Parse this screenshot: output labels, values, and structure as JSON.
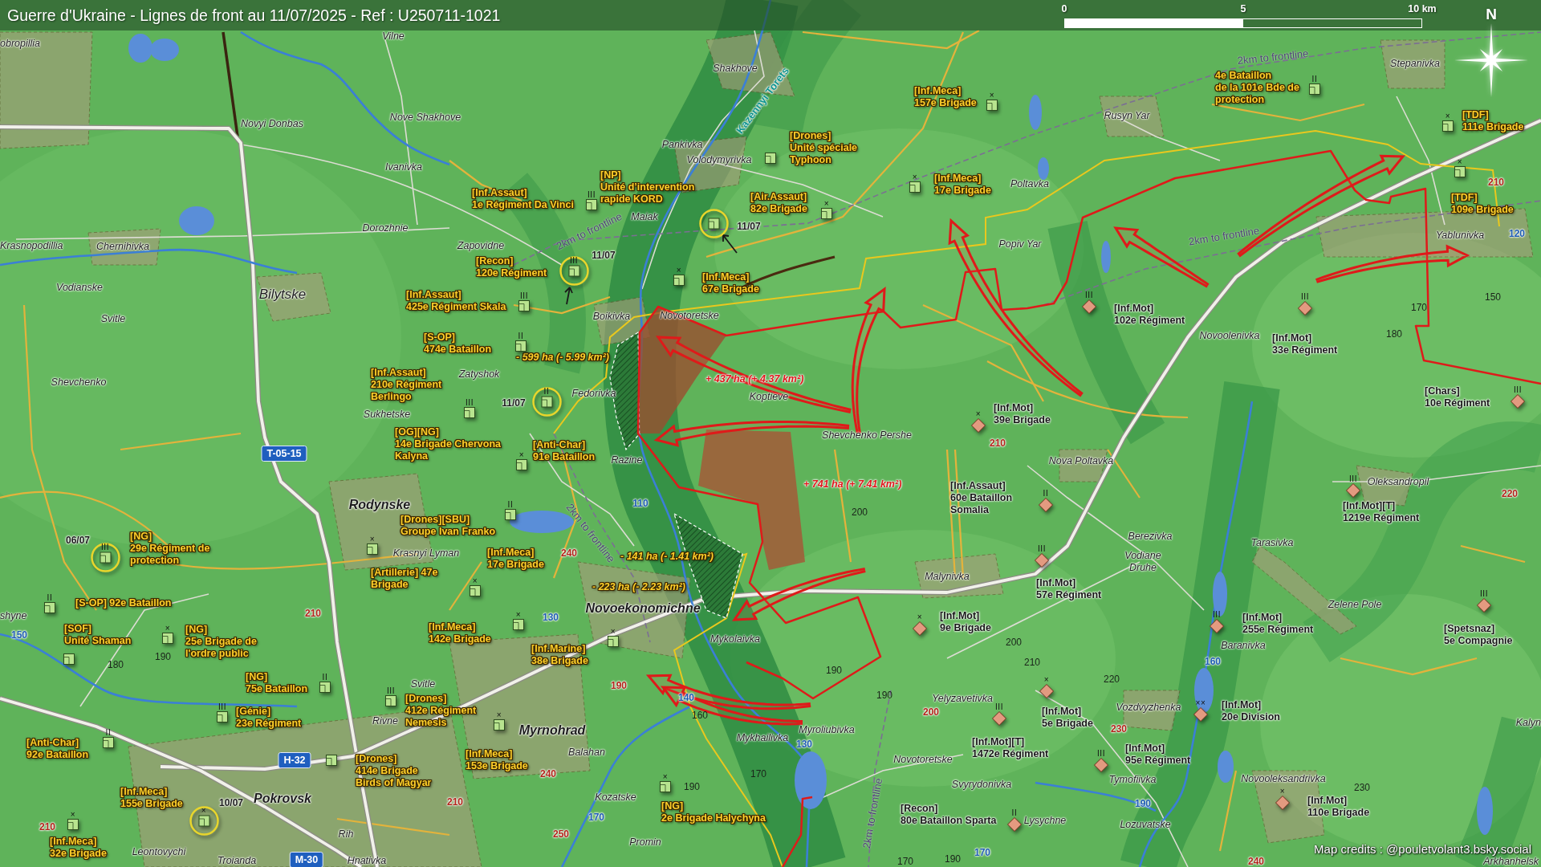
{
  "title": "Guerre d'Ukraine - Lignes de front au 11/07/2025 - Ref : U250711-1021",
  "scale_bar": {
    "ticks": [
      "0",
      "5",
      "10 km"
    ]
  },
  "compass": {
    "label": "N"
  },
  "places": [
    {
      "name": "Vilne",
      "kind": "village"
    },
    {
      "name": "obropillia",
      "kind": "village"
    },
    {
      "name": "Shakhove",
      "kind": "village"
    },
    {
      "name": "Stepanivka",
      "kind": "village"
    },
    {
      "name": "Nove Shakhove",
      "kind": "village"
    },
    {
      "name": "Rusyn Yar",
      "kind": "village"
    },
    {
      "name": "Novyi Donbas",
      "kind": "village"
    },
    {
      "name": "Pankivka",
      "kind": "village"
    },
    {
      "name": "Volodymyrivka",
      "kind": "village"
    },
    {
      "name": "Ivanivka",
      "kind": "village"
    },
    {
      "name": "Poltavka",
      "kind": "village"
    },
    {
      "name": "Maiak",
      "kind": "village"
    },
    {
      "name": "Dorozhnie",
      "kind": "village"
    },
    {
      "name": "Yablunivka",
      "kind": "village"
    },
    {
      "name": "Krasnopodillia",
      "kind": "village"
    },
    {
      "name": "Chernihivka",
      "kind": "village"
    },
    {
      "name": "Zapovidne",
      "kind": "village"
    },
    {
      "name": "Popiv Yar",
      "kind": "village"
    },
    {
      "name": "Vodianske",
      "kind": "village"
    },
    {
      "name": "Bilytske",
      "kind": "town"
    },
    {
      "name": "Svitle",
      "kind": "village"
    },
    {
      "name": "Boikivka",
      "kind": "village"
    },
    {
      "name": "Novotoretske",
      "kind": "village"
    },
    {
      "name": "Novoolenivka",
      "kind": "village"
    },
    {
      "name": "Zatyshok",
      "kind": "village"
    },
    {
      "name": "Shevchenko",
      "kind": "village"
    },
    {
      "name": "Fedorivka",
      "kind": "village"
    },
    {
      "name": "Koptieve",
      "kind": "village"
    },
    {
      "name": "Sukhetske",
      "kind": "village"
    },
    {
      "name": "Shevchenko Pershe",
      "kind": "village"
    },
    {
      "name": "Razine",
      "kind": "village"
    },
    {
      "name": "Nova Poltavka",
      "kind": "village"
    },
    {
      "name": "Oleksandropil",
      "kind": "village"
    },
    {
      "name": "Rodynske",
      "kind": "city"
    },
    {
      "name": "Berezivka",
      "kind": "village"
    },
    {
      "name": "Tarasivka",
      "kind": "village"
    },
    {
      "name": "Krasnyi Lyman",
      "kind": "village"
    },
    {
      "name": "Vodiane Druhe",
      "kind": "village"
    },
    {
      "name": "Malynivka",
      "kind": "village"
    },
    {
      "name": "shyne",
      "kind": "village"
    },
    {
      "name": "Novoekonomichne",
      "kind": "city"
    },
    {
      "name": "Zelene Pole",
      "kind": "village"
    },
    {
      "name": "Mykolaivka",
      "kind": "village"
    },
    {
      "name": "Baranivka",
      "kind": "village"
    },
    {
      "name": "Svitle",
      "kind": "village"
    },
    {
      "name": "Yelyzavetivka",
      "kind": "village"
    },
    {
      "name": "Vozdvyzhenka",
      "kind": "village"
    },
    {
      "name": "Rivne",
      "kind": "village"
    },
    {
      "name": "Kalyn",
      "kind": "village"
    },
    {
      "name": "Myrnohrad",
      "kind": "city"
    },
    {
      "name": "Myroliubivka",
      "kind": "village"
    },
    {
      "name": "Mykhailivka",
      "kind": "village"
    },
    {
      "name": "Balahan",
      "kind": "village"
    },
    {
      "name": "Novotoretske",
      "kind": "village"
    },
    {
      "name": "Svyrydonivka",
      "kind": "village"
    },
    {
      "name": "Tymofiivka",
      "kind": "village"
    },
    {
      "name": "Novooleksandrivka",
      "kind": "village"
    },
    {
      "name": "Pokrovsk",
      "kind": "city"
    },
    {
      "name": "Kozatske",
      "kind": "village"
    },
    {
      "name": "Lysychne",
      "kind": "village"
    },
    {
      "name": "Lozuvatske",
      "kind": "village"
    },
    {
      "name": "Rih",
      "kind": "village"
    },
    {
      "name": "Promin",
      "kind": "village"
    },
    {
      "name": "Leontovychi",
      "kind": "village"
    },
    {
      "name": "Troianda",
      "kind": "village"
    },
    {
      "name": "Hnativka",
      "kind": "village"
    },
    {
      "name": "Arkhanhelsk",
      "kind": "village"
    }
  ],
  "rivers": [
    "Kazennyi Torets"
  ],
  "buffer_labels": [
    "2km to frontline",
    "2km to frontline",
    "2km to frontline",
    "2km to frontline",
    "2km to frontline"
  ],
  "road_shields": [
    "T-05-15",
    "H-32",
    "M-30"
  ],
  "elevations": [
    {
      "value": "210",
      "kind": "spot"
    },
    {
      "value": "120",
      "kind": "water"
    },
    {
      "value": "150",
      "kind": "contour"
    },
    {
      "value": "170",
      "kind": "contour"
    },
    {
      "value": "180",
      "kind": "contour"
    },
    {
      "value": "210",
      "kind": "spot"
    },
    {
      "value": "220",
      "kind": "spot"
    },
    {
      "value": "110",
      "kind": "water"
    },
    {
      "value": "200",
      "kind": "contour"
    },
    {
      "value": "240",
      "kind": "spot"
    },
    {
      "value": "210",
      "kind": "spot"
    },
    {
      "value": "130",
      "kind": "water"
    },
    {
      "value": "150",
      "kind": "water"
    },
    {
      "value": "200",
      "kind": "contour"
    },
    {
      "value": "190",
      "kind": "contour"
    },
    {
      "value": "180",
      "kind": "contour"
    },
    {
      "value": "210",
      "kind": "contour"
    },
    {
      "value": "160",
      "kind": "water"
    },
    {
      "value": "190",
      "kind": "contour"
    },
    {
      "value": "220",
      "kind": "contour"
    },
    {
      "value": "190",
      "kind": "spot"
    },
    {
      "value": "140",
      "kind": "water"
    },
    {
      "value": "190",
      "kind": "contour"
    },
    {
      "value": "160",
      "kind": "contour"
    },
    {
      "value": "200",
      "kind": "spot"
    },
    {
      "value": "230",
      "kind": "spot"
    },
    {
      "value": "130",
      "kind": "water"
    },
    {
      "value": "240",
      "kind": "spot"
    },
    {
      "value": "170",
      "kind": "contour"
    },
    {
      "value": "190",
      "kind": "contour"
    },
    {
      "value": "230",
      "kind": "contour"
    },
    {
      "value": "210",
      "kind": "spot"
    },
    {
      "value": "190",
      "kind": "water"
    },
    {
      "value": "170",
      "kind": "water"
    },
    {
      "value": "210",
      "kind": "spot"
    },
    {
      "value": "250",
      "kind": "spot"
    },
    {
      "value": "170",
      "kind": "water"
    },
    {
      "value": "170",
      "kind": "contour"
    },
    {
      "value": "190",
      "kind": "contour"
    },
    {
      "value": "240",
      "kind": "spot"
    }
  ],
  "area_changes": [
    {
      "text": "- 599 ha (- 5.99 km²)",
      "kind": "loss"
    },
    {
      "text": "+ 437 ha (+ 4.37 km²)",
      "kind": "gain"
    },
    {
      "text": "+ 741 ha (+ 7.41 km²)",
      "kind": "gain"
    },
    {
      "text": "- 141 ha (- 1.41 km²)",
      "kind": "loss"
    },
    {
      "text": "- 223 ha (- 2.23 km²)",
      "kind": "loss"
    }
  ],
  "units": [
    {
      "kind": "ukrainian",
      "lines": [
        "[Inf.Meca]",
        "157e Brigade"
      ],
      "marker": {
        "echelon": "×",
        "highlighted": false
      }
    },
    {
      "kind": "ukrainian",
      "lines": [
        "4e Bataillon",
        "de la 101e Bde de",
        "protection"
      ],
      "marker": {
        "echelon": "II",
        "highlighted": false
      }
    },
    {
      "kind": "ukrainian",
      "lines": [
        "[TDF]",
        "111e Brigade"
      ],
      "marker": {
        "echelon": "×",
        "highlighted": false
      }
    },
    {
      "kind": "ukrainian",
      "lines": [
        "[Drones]",
        "Unité spéciale",
        "Typhoon"
      ],
      "marker": {
        "highlighted": false
      }
    },
    {
      "kind": "ukrainian",
      "lines": [
        "[Inf.Assaut]",
        "1e Régiment Da Vinci"
      ],
      "marker": {
        "echelon": "III",
        "highlighted": false
      }
    },
    {
      "kind": "ukrainian",
      "lines": [
        "[NP]",
        "Unité d’intervention",
        "rapide KORD"
      ],
      "marker": {
        "highlighted": true,
        "date": "11/07"
      }
    },
    {
      "kind": "ukrainian",
      "lines": [
        "[Inf.Meca]",
        "17e Brigade"
      ],
      "marker": {
        "echelon": "×",
        "highlighted": false
      }
    },
    {
      "kind": "ukrainian",
      "lines": [
        "[Air.Assaut]",
        "82e Brigade"
      ],
      "marker": {
        "echelon": "×",
        "highlighted": false
      }
    },
    {
      "kind": "ukrainian",
      "lines": [
        "[TDF]",
        "109e Brigade"
      ],
      "marker": {
        "echelon": "×",
        "highlighted": false
      }
    },
    {
      "kind": "ukrainian",
      "lines": [
        "[Recon]",
        "120e Régiment"
      ],
      "marker": {
        "echelon": "III",
        "highlighted": true,
        "date": "11/07"
      }
    },
    {
      "kind": "ukrainian",
      "lines": [
        "[Inf.Meca]",
        "67e Brigade"
      ],
      "marker": {
        "echelon": "×",
        "highlighted": false
      }
    },
    {
      "kind": "ukrainian",
      "lines": [
        "[Inf.Assaut]",
        "425e Régiment Skala"
      ],
      "marker": {
        "echelon": "III",
        "highlighted": false
      }
    },
    {
      "kind": "russian",
      "lines": [
        "[Inf.Mot]",
        "102e Régiment"
      ],
      "marker": {
        "echelon": "III",
        "highlighted": false
      }
    },
    {
      "kind": "ukrainian",
      "lines": [
        "[S-OP]",
        "474e Bataillon"
      ],
      "marker": {
        "echelon": "II",
        "highlighted": false
      }
    },
    {
      "kind": "russian",
      "lines": [
        "[Inf.Mot]",
        "33e Régiment"
      ],
      "marker": {
        "echelon": "III",
        "highlighted": false
      }
    },
    {
      "kind": "ukrainian",
      "lines": [
        "[Inf.Assaut]",
        "210e Régiment",
        "Berlingo"
      ],
      "marker": {
        "echelon": "III",
        "highlighted": false
      }
    },
    {
      "kind": "ukrainian",
      "marker": {
        "echelon": "II",
        "highlighted": true,
        "date": "11/07"
      }
    },
    {
      "kind": "russian",
      "lines": [
        "[Chars]",
        "10e Régiment"
      ],
      "marker": {
        "echelon": "III",
        "highlighted": false
      }
    },
    {
      "kind": "russian",
      "lines": [
        "[Inf.Mot]",
        "39e Brigade"
      ],
      "marker": {
        "echelon": "×",
        "highlighted": false
      }
    },
    {
      "kind": "ukrainian",
      "lines": [
        "[OG][NG]",
        "14e Brigade Chervona",
        "Kalyna"
      ],
      "marker": {
        "echelon": "×",
        "highlighted": false
      }
    },
    {
      "kind": "ukrainian",
      "lines": [
        "[Anti-Char]",
        "91e Bataillon"
      ]
    },
    {
      "kind": "russian",
      "lines": [
        "[Inf.Assaut]",
        "60e Bataillon",
        "Somalia"
      ],
      "marker": {
        "echelon": "II",
        "highlighted": false
      }
    },
    {
      "kind": "ukrainian",
      "lines": [
        "[Drones][SBU]",
        "Groupe Ivan Franko"
      ],
      "marker": {
        "echelon": "II",
        "highlighted": false
      }
    },
    {
      "kind": "russian",
      "lines": [
        "[Inf.Mot][T]",
        "1219e Régiment"
      ],
      "marker": {
        "echelon": "III",
        "highlighted": false
      }
    },
    {
      "kind": "ukrainian",
      "lines": [
        "[NG]",
        "29e Régiment de",
        "protection"
      ],
      "marker": {
        "echelon": "III",
        "highlighted": true,
        "date": "06/07"
      }
    },
    {
      "kind": "ukrainian",
      "lines": [
        "[Artillerie] 47e",
        "Brigade"
      ],
      "marker": {
        "echelon": "×",
        "highlighted": false
      }
    },
    {
      "kind": "ukrainian",
      "lines": [
        "[Inf.Meca]",
        "17e Brigade"
      ],
      "marker": {
        "echelon": "×",
        "highlighted": false
      }
    },
    {
      "kind": "russian",
      "lines": [
        "[Inf.Mot]",
        "57e Régiment"
      ],
      "marker": {
        "echelon": "III",
        "highlighted": false
      }
    },
    {
      "kind": "ukrainian",
      "lines": [
        "[S-OP] 92e Bataillon"
      ],
      "marker": {
        "echelon": "II",
        "highlighted": false
      }
    },
    {
      "kind": "ukrainian",
      "lines": [
        "[SOF]",
        "Unité Shaman"
      ],
      "marker": {
        "highlighted": false
      }
    },
    {
      "kind": "ukrainian",
      "lines": [
        "[NG]",
        "25e Brigade de",
        "l'ordre public"
      ],
      "marker": {
        "echelon": "×",
        "highlighted": false
      }
    },
    {
      "kind": "ukrainian",
      "lines": [
        "[Inf.Meca]",
        "142e Brigade"
      ],
      "marker": {
        "echelon": "×",
        "highlighted": false
      }
    },
    {
      "kind": "russian",
      "lines": [
        "[Inf.Mot]",
        "9e Brigade"
      ],
      "marker": {
        "echelon": "×",
        "highlighted": false
      }
    },
    {
      "kind": "russian",
      "lines": [
        "[Inf.Mot]",
        "255e Régiment"
      ],
      "marker": {
        "echelon": "III",
        "highlighted": false
      }
    },
    {
      "kind": "russian",
      "lines": [
        "[Spetsnaz]",
        "5e Compagnie"
      ],
      "marker": {
        "echelon": "III",
        "highlighted": false
      }
    },
    {
      "kind": "ukrainian",
      "lines": [
        "[Inf.Marine]",
        "38e Brigade"
      ],
      "marker": {
        "echelon": "×",
        "highlighted": false
      }
    },
    {
      "kind": "ukrainian",
      "lines": [
        "[NG]",
        "75e Bataillon"
      ],
      "marker": {
        "echelon": "II",
        "highlighted": false
      }
    },
    {
      "kind": "ukrainian",
      "lines": [
        "[Génie]",
        "23e Régiment"
      ],
      "marker": {
        "echelon": "III",
        "highlighted": false
      }
    },
    {
      "kind": "ukrainian",
      "lines": [
        "[Drones]",
        "412e Régiment",
        "Nemesis"
      ],
      "marker": {
        "echelon": "III",
        "highlighted": false
      }
    },
    {
      "kind": "russian",
      "lines": [
        "[Inf.Mot]",
        "5e Brigade"
      ],
      "marker": {
        "echelon": "×",
        "highlighted": false
      }
    },
    {
      "kind": "russian",
      "lines": [
        "[Inf.Mot][T]",
        "1472e Régiment"
      ],
      "marker": {
        "echelon": "III",
        "highlighted": false
      }
    },
    {
      "kind": "russian",
      "lines": [
        "[Inf.Mot]",
        "20e Division"
      ],
      "marker": {
        "echelon": "××",
        "highlighted": false
      }
    },
    {
      "kind": "ukrainian",
      "lines": [
        "[Anti-Char]",
        "92e Bataillon"
      ],
      "marker": {
        "echelon": "II",
        "highlighted": false
      }
    },
    {
      "kind": "ukrainian",
      "lines": [
        "[Drones]",
        "414e Brigade",
        "Birds of Magyar"
      ],
      "marker": {
        "highlighted": false
      }
    },
    {
      "kind": "ukrainian",
      "lines": [
        "[Inf.Meca]",
        "153e Brigade"
      ],
      "marker": {
        "echelon": "×",
        "highlighted": false
      }
    },
    {
      "kind": "russian",
      "lines": [
        "[Inf.Mot]",
        "95e Régiment"
      ],
      "marker": {
        "echelon": "III",
        "highlighted": false
      }
    },
    {
      "kind": "ukrainian",
      "lines": [
        "[Inf.Meca]",
        "155e Brigade"
      ],
      "marker": {
        "echelon": "×",
        "highlighted": true,
        "date": "10/07"
      }
    },
    {
      "kind": "ukrainian",
      "lines": [
        "[NG]",
        "2e Brigade Halychyna"
      ],
      "marker": {
        "echelon": "×",
        "highlighted": false
      }
    },
    {
      "kind": "russian",
      "lines": [
        "[Recon]",
        "80e Bataillon Sparta"
      ],
      "marker": {
        "echelon": "II",
        "highlighted": false
      }
    },
    {
      "kind": "russian",
      "lines": [
        "[Inf.Mot]",
        "110e Brigade"
      ],
      "marker": {
        "echelon": "×",
        "highlighted": false
      }
    },
    {
      "kind": "ukrainian",
      "lines": [
        "[Inf.Meca]",
        "32e Brigade"
      ],
      "marker": {
        "echelon": "×",
        "highlighted": false
      }
    }
  ],
  "credits": "Map credits : @pouletvolant3.bsky.social"
}
